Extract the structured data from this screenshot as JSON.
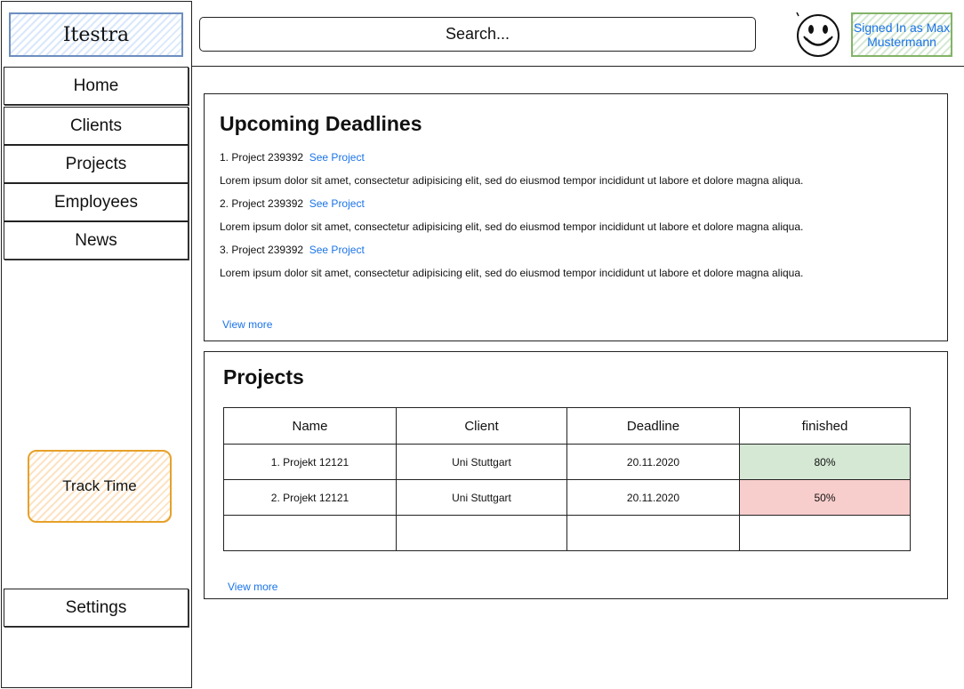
{
  "app": {
    "logo": "Itestra"
  },
  "sidebar": {
    "items": [
      {
        "label": "Home"
      },
      {
        "label": "Clients"
      },
      {
        "label": "Projects"
      },
      {
        "label": "Employees"
      },
      {
        "label": "News"
      }
    ],
    "track_time": "Track Time",
    "settings": "Settings"
  },
  "header": {
    "search_label": "Search...",
    "signed_in_line1": "Signed In as Max",
    "signed_in_line2": "Mustermann"
  },
  "deadlines": {
    "title": "Upcoming Deadlines",
    "items": [
      {
        "label": "1. Project 239392",
        "link": "See Project",
        "text": "Lorem ipsum dolor sit amet, consectetur adipisicing elit, sed do eiusmod tempor incididunt ut labore et dolore magna aliqua."
      },
      {
        "label": "2. Project 239392",
        "link": "See Project",
        "text": "Lorem ipsum dolor sit amet, consectetur adipisicing elit, sed do eiusmod tempor incididunt ut labore et dolore magna aliqua."
      },
      {
        "label": "3. Project 239392",
        "link": "See Project",
        "text": "Lorem ipsum dolor sit amet, consectetur adipisicing elit, sed do eiusmod tempor incididunt ut labore et dolore magna aliqua."
      }
    ],
    "view_more": "View more"
  },
  "projects": {
    "title": "Projects",
    "columns": [
      "Name",
      "Client",
      "Deadline",
      "finished"
    ],
    "rows": [
      {
        "name": "1. Projekt 12121",
        "client": "Uni Stuttgart",
        "deadline": "20.11.2020",
        "finished": "80%",
        "status_color": "#d5e8d4"
      },
      {
        "name": "2. Projekt 12121",
        "client": "Uni Stuttgart",
        "deadline": "20.11.2020",
        "finished": "50%",
        "status_color": "#f8cecc"
      },
      {
        "name": "",
        "client": "",
        "deadline": "",
        "finished": ""
      }
    ],
    "view_more": "View more"
  },
  "colors": {
    "link": "#1a73e8",
    "logo_border": "#6c8ebf",
    "track_border": "#e6a12a",
    "signed_border": "#82b366"
  }
}
